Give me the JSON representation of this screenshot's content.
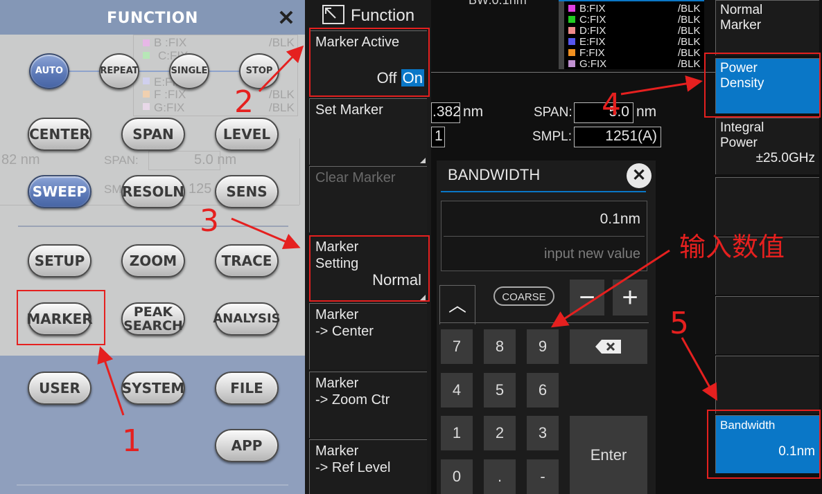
{
  "function_panel": {
    "title": "FUNCTION",
    "close_icon": "close-icon",
    "buttons_row1": [
      "AUTO",
      "REPEAT",
      "SINGLE",
      "STOP"
    ],
    "buttons_row2": [
      "CENTER",
      "SPAN",
      "LEVEL"
    ],
    "buttons_row3": [
      "SWEEP",
      "RESOLN",
      "SENS"
    ],
    "buttons_row4": [
      "SETUP",
      "ZOOM",
      "TRACE"
    ],
    "buttons_row5": [
      "MARKER",
      "PEAK SEARCH",
      "ANALYSIS"
    ],
    "buttons_row6": [
      "USER",
      "SYSTEM",
      "FILE"
    ],
    "buttons_row7": [
      "APP"
    ],
    "ghost_traces": [
      "B :FIX",
      "C:FIX",
      "D:FIX",
      "E:FIX",
      "F :FIX",
      "G:FIX"
    ],
    "ghost_blk": "/BLK",
    "ghost_nm": "82 nm",
    "ghost_span": "SPAN:",
    "ghost_span_val": "5.0 nm",
    "ghost_sm": "SM",
    "ghost_125": "125"
  },
  "softkeys": {
    "header": "Function",
    "marker_active": {
      "label": "Marker Active",
      "off": "Off",
      "on": "On"
    },
    "set_marker": "Set Marker",
    "clear_marker": "Clear Marker",
    "marker_setting": {
      "label1": "Marker",
      "label2": "Setting",
      "value": "Normal"
    },
    "marker_center": {
      "label1": "Marker",
      "label2": "-> Center"
    },
    "marker_zoom": {
      "label1": "Marker",
      "label2": "-> Zoom Ctr"
    },
    "marker_ref": {
      "label1": "Marker",
      "label2": "-> Ref Level"
    }
  },
  "screen": {
    "bw_top": "BW:0.1nm",
    "traces": [
      {
        "name": "B:FIX",
        "blk": "/BLK",
        "color": "#e040e0"
      },
      {
        "name": "C:FIX",
        "blk": "/BLK",
        "color": "#22cc22"
      },
      {
        "name": "D:FIX",
        "blk": "/BLK",
        "color": "#f08a8a"
      },
      {
        "name": "E:FIX",
        "blk": "/BLK",
        "color": "#5555ee"
      },
      {
        "name": "F:FIX",
        "blk": "/BLK",
        "color": "#f09020"
      },
      {
        "name": "G:FIX",
        "blk": "/BLK",
        "color": "#c090d0"
      }
    ],
    "center_val": ".382",
    "center_unit": "nm",
    "span_label": "SPAN:",
    "span_val": "5.0",
    "span_unit": "nm",
    "res_val": "1",
    "smpl_label": "SMPL:",
    "smpl_val": "1251(A)",
    "right_soft": {
      "normal_marker": {
        "l1": "Normal",
        "l2": "Marker"
      },
      "power_density": {
        "l1": "Power",
        "l2": "Density"
      },
      "integral_power": {
        "l1": "Integral",
        "l2": "Power",
        "value": "±25.0GHz"
      },
      "bandwidth": {
        "label": "Bandwidth",
        "value": "0.1nm"
      }
    }
  },
  "bandwidth_dialog": {
    "title": "BANDWIDTH",
    "value": "0.1nm",
    "placeholder": "input new value",
    "coarse": "COARSE",
    "minus": "−",
    "plus": "+",
    "keys": [
      "7",
      "8",
      "9",
      "4",
      "5",
      "6",
      "1",
      "2",
      "3",
      "0",
      ".",
      "-"
    ],
    "enter": "Enter"
  },
  "annotations": {
    "n1": "1",
    "n2": "2",
    "n3": "3",
    "n4": "4",
    "n5": "5",
    "input_value": "输入数值",
    "color": "#e5201f"
  }
}
